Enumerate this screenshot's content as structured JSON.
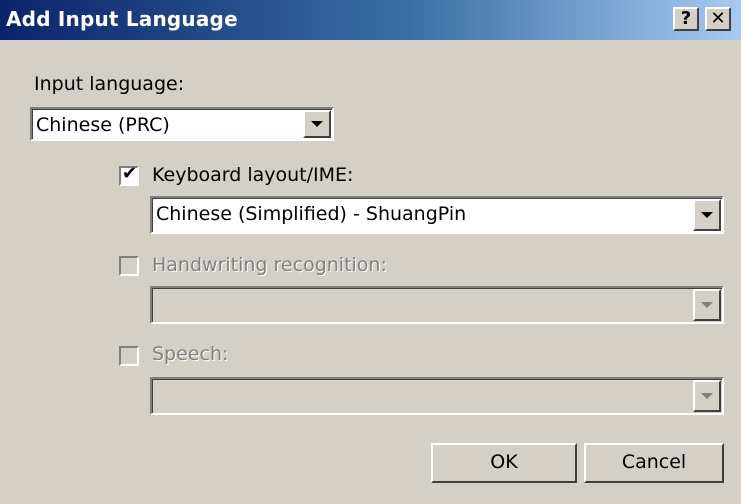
{
  "window": {
    "title": "Add Input Language",
    "help_glyph": "?",
    "close_glyph": "✕"
  },
  "input_language": {
    "label": "Input language:",
    "value": "Chinese (PRC)"
  },
  "keyboard_layout": {
    "label": "Keyboard layout/IME:",
    "checked": true,
    "value": "Chinese (Simplified) - ShuangPin"
  },
  "handwriting": {
    "label": "Handwriting recognition:",
    "checked": false,
    "enabled": false,
    "value": ""
  },
  "speech": {
    "label": "Speech:",
    "checked": false,
    "enabled": false,
    "value": ""
  },
  "buttons": {
    "ok": "OK",
    "cancel": "Cancel"
  },
  "icons": {
    "dropdown": "chevron-down-icon",
    "check": "checkmark-icon"
  },
  "colors": {
    "titlebar_start": "#0a246a",
    "titlebar_end": "#a6caf0",
    "face": "#d4d0c8",
    "disabled_text": "#808080"
  }
}
